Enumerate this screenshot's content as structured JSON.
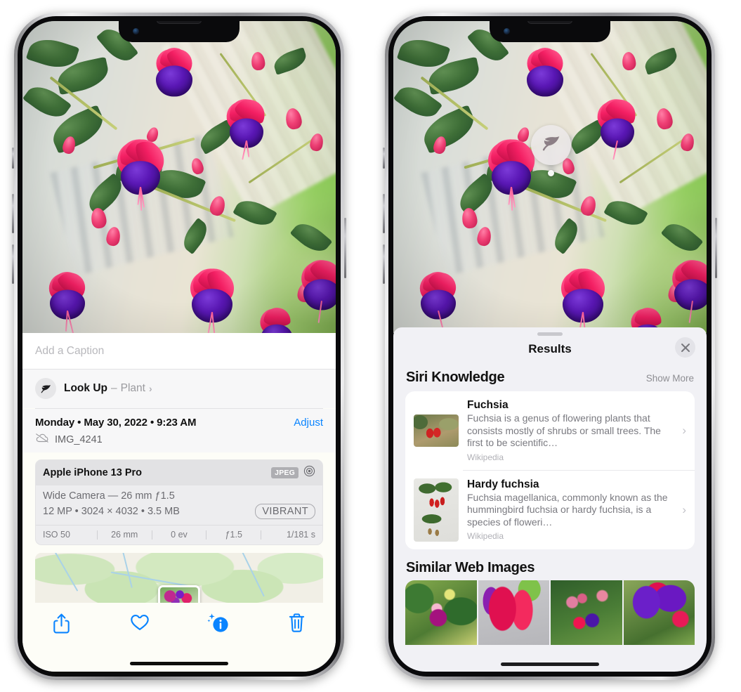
{
  "left_phone": {
    "caption_placeholder": "Add a Caption",
    "lookup": {
      "label": "Look Up",
      "dash": "–",
      "subject": "Plant",
      "chevron": "›",
      "icon": "leaf-icon"
    },
    "meta": {
      "date": "Monday • May 30, 2022 • 9:23 AM",
      "adjust_label": "Adjust",
      "filename": "IMG_4241",
      "cloud_icon": "icloud-slash-icon"
    },
    "camera_card": {
      "device": "Apple iPhone 13 Pro",
      "format_tag": "JPEG",
      "aperture_icon": "aperture-icon",
      "lens_line": "Wide Camera — 26 mm ƒ1.5",
      "specs_line": "12 MP • 3024 × 4032 • 3.5 MB",
      "style_pill": "VIBRANT",
      "exif": [
        "ISO 50",
        "26 mm",
        "0 ev",
        "ƒ1.5",
        "1/181 s"
      ]
    },
    "toolbar": [
      {
        "name": "share-icon",
        "label": "Share"
      },
      {
        "name": "heart-icon",
        "label": "Favorite"
      },
      {
        "name": "info-sparkle-icon",
        "label": "Info"
      },
      {
        "name": "trash-icon",
        "label": "Delete"
      }
    ]
  },
  "right_phone": {
    "visual_lookup_badge": {
      "icon": "leaf-icon"
    },
    "sheet": {
      "title": "Results",
      "close_label": "✕",
      "siri_section": {
        "heading": "Siri Knowledge",
        "action": "Show More"
      },
      "results": [
        {
          "title": "Fuchsia",
          "description": "Fuchsia is a genus of flowering plants that consists mostly of shrubs or small trees. The first to be scientific…",
          "source": "Wikipedia",
          "chevron": "›"
        },
        {
          "title": "Hardy fuchsia",
          "description": "Fuchsia magellanica, commonly known as the hummingbird fuchsia or hardy fuchsia, is a species of floweri…",
          "source": "Wikipedia",
          "chevron": "›"
        }
      ],
      "similar_section": {
        "heading": "Similar Web Images"
      }
    }
  },
  "colors": {
    "accent_blue": "#0a84ff",
    "sheet_bg": "#f1f1f5",
    "card_bg": "#ffffff",
    "secondary_text": "#8e8e93"
  }
}
